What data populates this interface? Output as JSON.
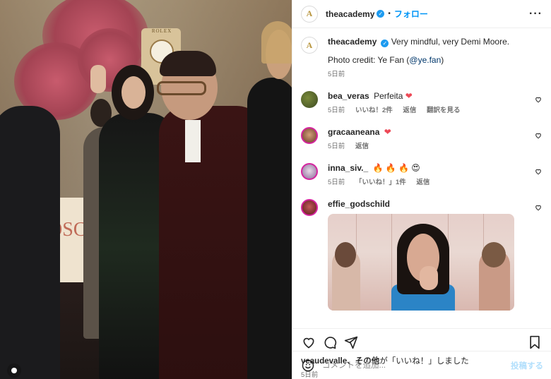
{
  "photo": {
    "brand_text": "ROLEX",
    "sign_text": "OSC"
  },
  "header": {
    "logo_letter": "A",
    "username": "theacademy",
    "separator": "•",
    "follow_label": "フォロー",
    "more_label": "···"
  },
  "caption": {
    "username": "theacademy",
    "text": "Very mindful, very Demi Moore.",
    "credit_prefix": "Photo credit: Ye Fan (",
    "credit_link": "@ye.fan",
    "credit_suffix": ")",
    "time": "5日前"
  },
  "comments": [
    {
      "username": "bea_veras",
      "text": "Perfeita",
      "emoji": "❤",
      "time": "5日前",
      "likes": "いいね！2件",
      "reply": "返信",
      "translate": "翻訳を見る"
    },
    {
      "username": "gracaaneana",
      "text": "",
      "emoji": "❤",
      "time": "5日前",
      "reply": "返信"
    },
    {
      "username": "inna_siv._",
      "text": "",
      "emoji": "🔥 🔥 🔥 😍",
      "time": "5日前",
      "likes": "「いいね！」1件",
      "reply": "返信"
    },
    {
      "username": "effie_godschild",
      "text": "",
      "gif_caption": ""
    }
  ],
  "likes_line": {
    "users": "veaudevalle、その他",
    "suffix": "が「いいね！」しました"
  },
  "post_date": "5日前",
  "composer": {
    "placeholder": "コメントを追加...",
    "post_label": "投稿する"
  },
  "colors": {
    "accent": "#0095f6",
    "verified": "#1d9bf0",
    "heart_red": "#ed4956",
    "post_disabled": "#b2dffc"
  }
}
